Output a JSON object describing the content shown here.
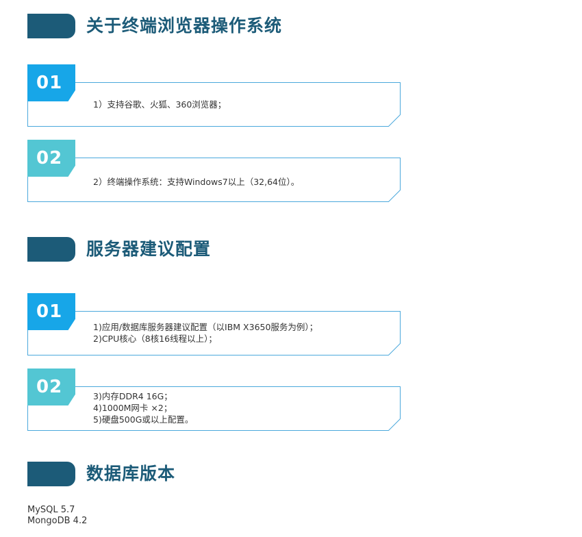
{
  "sections": [
    {
      "title": "关于终端浏览器操作系统",
      "cards": [
        {
          "number": "01",
          "lines": [
            "1）支持谷歌、火狐、360浏览器；"
          ]
        },
        {
          "number": "02",
          "lines": [
            "2）终端操作系统：支持Windows7以上（32,64位）。"
          ]
        }
      ]
    },
    {
      "title": "服务器建议配置",
      "cards": [
        {
          "number": "01",
          "lines": [
            "1)应用/数据库服务器建议配置（以IBM X3650服务为例）；",
            "2)CPU核心（8核16线程以上）；"
          ]
        },
        {
          "number": "02",
          "lines": [
            "3)内存DDR4 16G；",
            "4)1000M网卡 ×2；",
            "5)硬盘500G或以上配置。"
          ]
        }
      ]
    },
    {
      "title": "数据库版本",
      "items": [
        "MySQL 5.7",
        "MongoDB 4.2"
      ]
    }
  ],
  "colors": {
    "title": "#1c5b78",
    "tab": "#1c5b78",
    "badge_blue": "#17a6e8",
    "badge_teal": "#53c6d3",
    "card_border": "#4aa8dc",
    "text": "#333333"
  }
}
